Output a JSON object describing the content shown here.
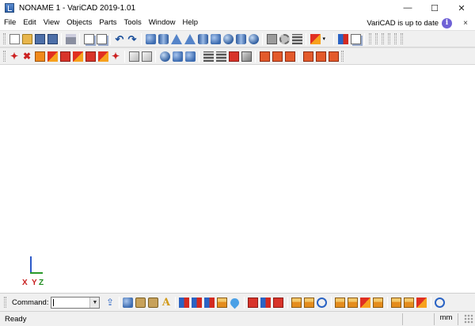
{
  "window": {
    "title": "NONAME 1 - VariCAD 2019-1.01",
    "minimize_glyph": "—",
    "maximize_glyph": "☐",
    "close_glyph": "✕"
  },
  "menu": {
    "items": [
      "File",
      "Edit",
      "View",
      "Objects",
      "Parts",
      "Tools",
      "Window",
      "Help"
    ],
    "update_status": "VariCAD is up to date",
    "info_glyph": "i",
    "close_doc_glyph": "×"
  },
  "axes": {
    "x": "X",
    "y": "Y",
    "z": "Z"
  },
  "command": {
    "label": "Command:",
    "value": "",
    "dropdown_glyph": "▼"
  },
  "status": {
    "text": "Ready",
    "unit": "mm"
  },
  "colors": {
    "accent_blue": "#2d5ac9",
    "axis_x_red": "#c81e1e",
    "axis_z_green": "#1e8c1e",
    "info_purple": "#6f62d6"
  },
  "toolbar_icons": {
    "row1": [
      "new-document-icon",
      "open-folder-icon",
      "save-icon",
      "save-all-icon",
      "print-icon",
      "copy-icon",
      "paste-icon",
      "undo-icon",
      "redo-icon",
      "box-icon",
      "cylinder-icon",
      "cone-icon",
      "pyramid-icon",
      "truncated-cone-icon",
      "torus-icon",
      "sphere-icon",
      "pipe-icon",
      "gear-icon",
      "spring-icon",
      "import-icon",
      "part-icon",
      "bom-icon"
    ],
    "row2": [
      "edit-solid-icon",
      "delete-solid-icon",
      "move-solid-icon",
      "boolean-icon",
      "cut-icon",
      "weld-icon",
      "hole-icon",
      "mirror-icon",
      "measure-icon",
      "view-icon",
      "section-icon",
      "render-icon",
      "shading-icon",
      "visibility-icon",
      "drawing-icon",
      "layout-icon",
      "projection-icon",
      "group-icon"
    ],
    "command_row": [
      "export-icon",
      "solid-box-icon",
      "sheet-metal-icon",
      "bend-icon",
      "text-icon",
      "hierarchy-icon",
      "assembly-icon",
      "component-icon",
      "mates-icon",
      "color-icon",
      "red-blocks-icon",
      "blue-red-icon",
      "split-icon",
      "folder-icon",
      "folder-open-icon",
      "rotate-icon",
      "hand-icon",
      "hand-up-icon",
      "hand-cross-icon",
      "hand-check-icon",
      "book-icon",
      "book-up-icon",
      "book-cross-icon",
      "check-icon"
    ]
  }
}
